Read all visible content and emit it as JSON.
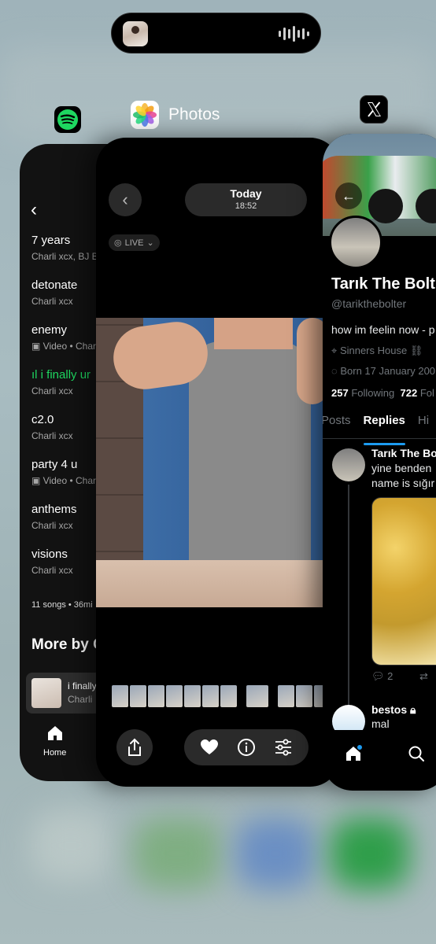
{
  "dynamic_island": {
    "now_playing_icon": "album-art-thumbnail",
    "wave_icon": "audio-waveform-icon"
  },
  "apps": {
    "spotify": {
      "icon": "spotify-icon",
      "tracks": [
        {
          "title": "7 years",
          "subtitle": "Charli xcx, BJ Bu",
          "video": false,
          "playing": false
        },
        {
          "title": "detonate",
          "subtitle": "Charli xcx",
          "video": false,
          "playing": false
        },
        {
          "title": "enemy",
          "subtitle": "Video • Char",
          "video": true,
          "playing": false
        },
        {
          "title": "i finally ur",
          "subtitle": "Charli xcx",
          "video": false,
          "playing": true
        },
        {
          "title": "c2.0",
          "subtitle": "Charli xcx",
          "video": false,
          "playing": false
        },
        {
          "title": "party 4 u",
          "subtitle": "Video • Char",
          "video": true,
          "playing": false
        },
        {
          "title": "anthems",
          "subtitle": "Charli xcx",
          "video": false,
          "playing": false
        },
        {
          "title": "visions",
          "subtitle": "Charli xcx",
          "video": false,
          "playing": false
        }
      ],
      "song_count": "11 songs • 36mi",
      "more_by": "More by C",
      "mini_player": {
        "title": "i finally",
        "artist": "Charli"
      },
      "nav_home": "Home",
      "accent": "#1ed760"
    },
    "photos": {
      "label": "Photos",
      "icon": "photos-app-icon",
      "date_day": "Today",
      "date_time": "18:52",
      "live_badge": "LIVE"
    },
    "x": {
      "icon": "x-logo-icon",
      "name": "Tarık The Bolt",
      "handle": "@tarikthebolter",
      "bio": "how im feelin now - p",
      "location": "Sinners House",
      "born": "Born 17 January 200",
      "following_count": "257",
      "following_label": "Following",
      "followers_count": "722",
      "followers_label": "Fol",
      "tabs": [
        "Posts",
        "Replies",
        "Hi"
      ],
      "active_tab": "Replies",
      "post": {
        "name": "Tarık The Bo",
        "line1": "yine benden",
        "line2": "name is sığır",
        "reply_count": "2"
      },
      "reply": {
        "name": "bestos",
        "text": "mal"
      },
      "accent": "#1d9bf0"
    }
  }
}
